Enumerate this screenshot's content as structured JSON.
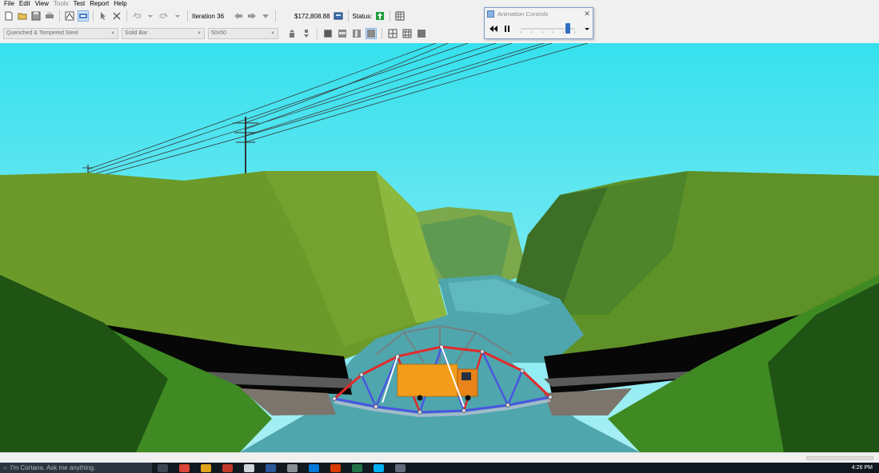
{
  "menu": {
    "items": [
      {
        "label": "File",
        "enabled": true
      },
      {
        "label": "Edit",
        "enabled": true
      },
      {
        "label": "View",
        "enabled": true
      },
      {
        "label": "Tools",
        "enabled": false
      },
      {
        "label": "Test",
        "enabled": true
      },
      {
        "label": "Report",
        "enabled": true
      },
      {
        "label": "Help",
        "enabled": true
      }
    ]
  },
  "toolbar": {
    "iteration_label": "Iteration 36",
    "cost_label": "$172,808.88",
    "status_label": "Status:",
    "status_icon": "status-ok-icon",
    "status_color": "#1e9e3a"
  },
  "member_selectors": {
    "material": "Quenched & Tempered Steel",
    "cross_section": "Solid Bar",
    "size": "50x50"
  },
  "animation_controls": {
    "title": "Animation Controls",
    "speed_level": 0.9
  },
  "taskbar": {
    "search_placeholder": "I'm Cortana. Ask me anything.",
    "clock": "4:26 PM"
  },
  "colors": {
    "sky_top": "#38e2ee",
    "sky_bottom": "#a3eef3",
    "water": "#4fa6ad",
    "hill": "#6b9a2a",
    "compression_member": "#e32a2a",
    "tension_member": "#4a55e0",
    "truck": "#f29c1a"
  }
}
